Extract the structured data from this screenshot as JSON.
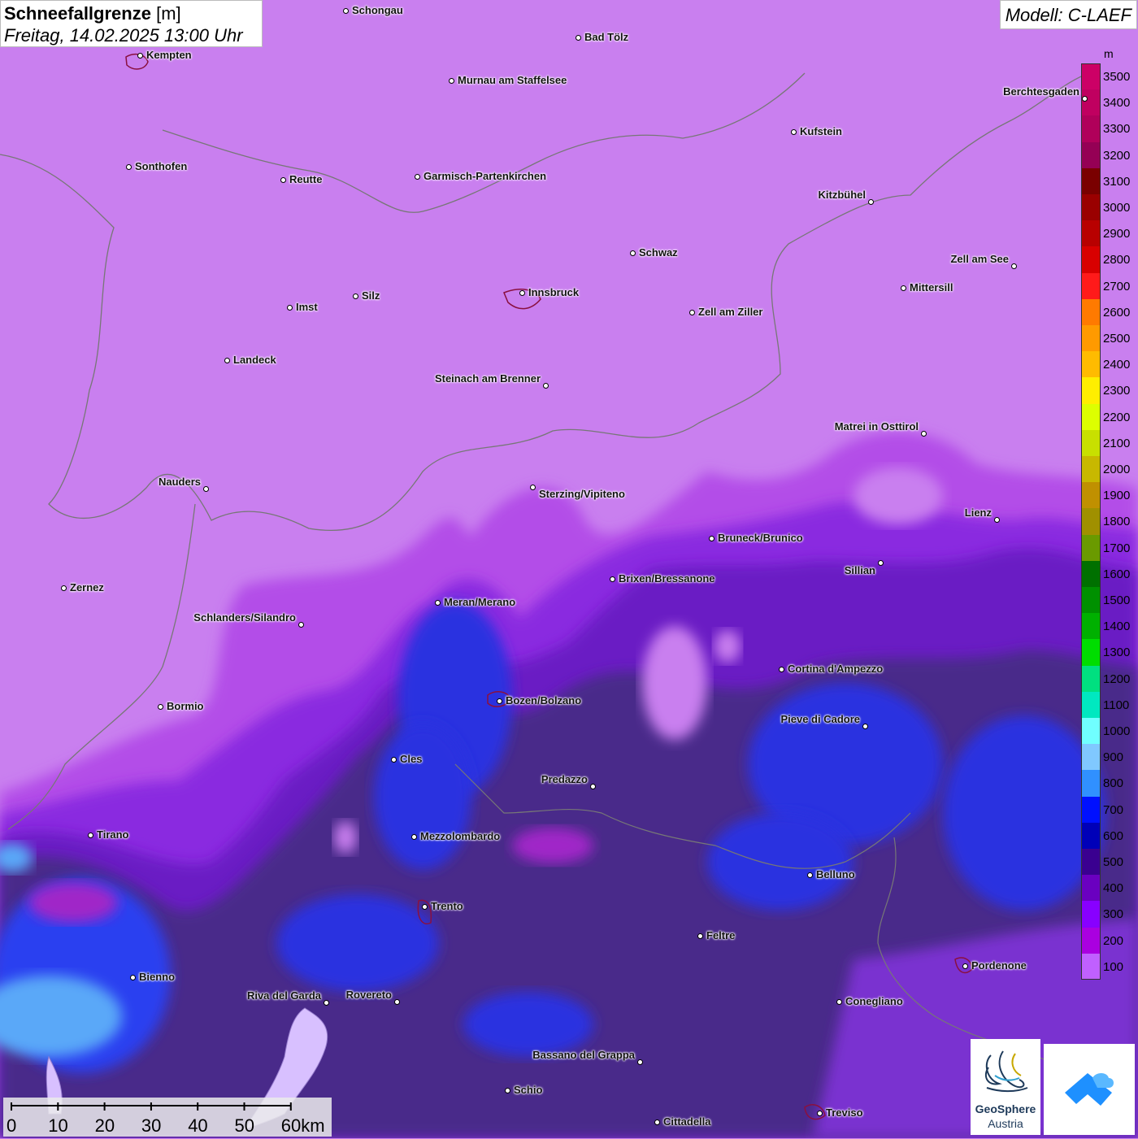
{
  "header": {
    "title_bold": "Schneefallgrenze",
    "title_unit": "[m]",
    "datetime": "Freitag, 14.02.2025 13:00 Uhr",
    "model": "Modell: C-LAEF"
  },
  "legend": {
    "unit": "m",
    "entries": [
      {
        "label": "3500",
        "color": "#cc0066"
      },
      {
        "label": "3400",
        "color": "#c00060"
      },
      {
        "label": "3300",
        "color": "#b0005a"
      },
      {
        "label": "3200",
        "color": "#950055"
      },
      {
        "label": "3100",
        "color": "#7a0000"
      },
      {
        "label": "3000",
        "color": "#9a0000"
      },
      {
        "label": "2900",
        "color": "#b80000"
      },
      {
        "label": "2800",
        "color": "#d80000"
      },
      {
        "label": "2700",
        "color": "#ff1a1a"
      },
      {
        "label": "2600",
        "color": "#ff7a00"
      },
      {
        "label": "2500",
        "color": "#ff9a00"
      },
      {
        "label": "2400",
        "color": "#ffbb00"
      },
      {
        "label": "2300",
        "color": "#ffee00"
      },
      {
        "label": "2200",
        "color": "#ddff00"
      },
      {
        "label": "2100",
        "color": "#c8e000"
      },
      {
        "label": "2000",
        "color": "#c8b800"
      },
      {
        "label": "1900",
        "color": "#c09000"
      },
      {
        "label": "1800",
        "color": "#a09000"
      },
      {
        "label": "1700",
        "color": "#6a9a00"
      },
      {
        "label": "1600",
        "color": "#007000"
      },
      {
        "label": "1500",
        "color": "#009000"
      },
      {
        "label": "1400",
        "color": "#00b000"
      },
      {
        "label": "1300",
        "color": "#00dd00"
      },
      {
        "label": "1200",
        "color": "#00e080"
      },
      {
        "label": "1100",
        "color": "#00e8c0"
      },
      {
        "label": "1000",
        "color": "#70ffff"
      },
      {
        "label": "900",
        "color": "#80c8ff"
      },
      {
        "label": "800",
        "color": "#3090ff"
      },
      {
        "label": "700",
        "color": "#0010ff"
      },
      {
        "label": "600",
        "color": "#0000b8"
      },
      {
        "label": "500",
        "color": "#3a0090"
      },
      {
        "label": "400",
        "color": "#6a00c0"
      },
      {
        "label": "300",
        "color": "#8800ff"
      },
      {
        "label": "200",
        "color": "#aa00e0"
      },
      {
        "label": "100",
        "color": "#c060ff"
      }
    ]
  },
  "cities": [
    {
      "name": "Schongau"
    },
    {
      "name": "Bad Tölz"
    },
    {
      "name": "Kempten"
    },
    {
      "name": "Murnau am Staffelsee"
    },
    {
      "name": "Berchtesgaden"
    },
    {
      "name": "Kufstein"
    },
    {
      "name": "Sonthofen"
    },
    {
      "name": "Reutte"
    },
    {
      "name": "Garmisch-Partenkirchen"
    },
    {
      "name": "Kitzbühel"
    },
    {
      "name": "Schwaz"
    },
    {
      "name": "Zell am See"
    },
    {
      "name": "Innsbruck"
    },
    {
      "name": "Mittersill"
    },
    {
      "name": "Imst"
    },
    {
      "name": "Silz"
    },
    {
      "name": "Zell am Ziller"
    },
    {
      "name": "Landeck"
    },
    {
      "name": "Steinach am Brenner"
    },
    {
      "name": "Matrei in Osttirol"
    },
    {
      "name": "Nauders"
    },
    {
      "name": "Sterzing/Vipiteno"
    },
    {
      "name": "Lienz"
    },
    {
      "name": "Bruneck/Brunico"
    },
    {
      "name": "Sillian"
    },
    {
      "name": "Zernez"
    },
    {
      "name": "Brixen/Bressanone"
    },
    {
      "name": "Meran/Merano"
    },
    {
      "name": "Schlanders/Silandro"
    },
    {
      "name": "Cortina d'Ampezzo"
    },
    {
      "name": "Bormio"
    },
    {
      "name": "Bozen/Bolzano"
    },
    {
      "name": "Pieve di Cadore"
    },
    {
      "name": "Cles"
    },
    {
      "name": "Predazzo"
    },
    {
      "name": "Tirano"
    },
    {
      "name": "Mezzolombardo"
    },
    {
      "name": "Belluno"
    },
    {
      "name": "Trento"
    },
    {
      "name": "Feltre"
    },
    {
      "name": "Pordenone"
    },
    {
      "name": "Bienno"
    },
    {
      "name": "Riva del Garda"
    },
    {
      "name": "Rovereto"
    },
    {
      "name": "Conegliano"
    },
    {
      "name": "Bassano del Grappa"
    },
    {
      "name": "Schio"
    },
    {
      "name": "Treviso"
    },
    {
      "name": "Cittadella"
    }
  ],
  "scale_bar": {
    "labels": [
      "0",
      "10",
      "20",
      "30",
      "40",
      "50",
      "60km"
    ]
  },
  "logos": {
    "geosphere_line1": "GeoSphere",
    "geosphere_line2": "Austria"
  }
}
